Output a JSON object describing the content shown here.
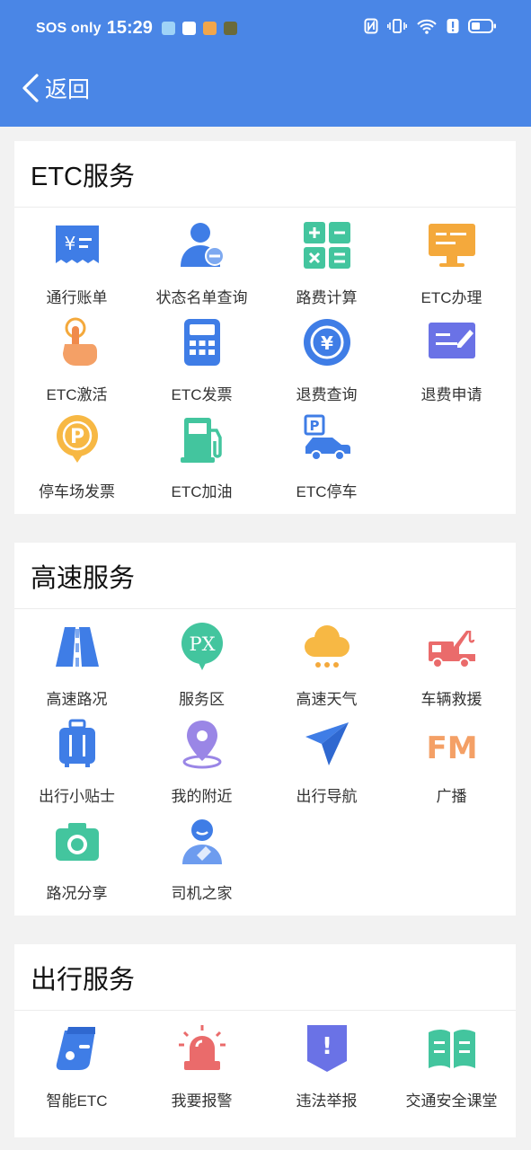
{
  "status": {
    "carrier": "SOS only",
    "time": "15:29"
  },
  "nav": {
    "back_label": "返回"
  },
  "sections": [
    {
      "title": "ETC服务",
      "items": [
        {
          "label": "通行账单"
        },
        {
          "label": "状态名单查询"
        },
        {
          "label": "路费计算"
        },
        {
          "label": "ETC办理"
        },
        {
          "label": "ETC激活"
        },
        {
          "label": "ETC发票"
        },
        {
          "label": "退费查询"
        },
        {
          "label": "退费申请"
        },
        {
          "label": "停车场发票"
        },
        {
          "label": "ETC加油"
        },
        {
          "label": "ETC停车"
        }
      ]
    },
    {
      "title": "高速服务",
      "items": [
        {
          "label": "高速路况"
        },
        {
          "label": "服务区"
        },
        {
          "label": "高速天气"
        },
        {
          "label": "车辆救援"
        },
        {
          "label": "出行小贴士"
        },
        {
          "label": "我的附近"
        },
        {
          "label": "出行导航"
        },
        {
          "label": "广播"
        },
        {
          "label": "路况分享"
        },
        {
          "label": "司机之家"
        }
      ]
    },
    {
      "title": "出行服务",
      "items": [
        {
          "label": "智能ETC"
        },
        {
          "label": "我要报警"
        },
        {
          "label": "违法举报"
        },
        {
          "label": "交通安全课堂"
        }
      ]
    }
  ],
  "icon_texts": {
    "yen": "¥",
    "parking": "P",
    "px": "PX",
    "fm": "FM",
    "exclaim": "!"
  },
  "colors": {
    "header": "#4a86e6",
    "primary_blue": "#3f7de6",
    "green": "#43c59e",
    "orange": "#f4a93c",
    "red": "#ea6b6b"
  }
}
